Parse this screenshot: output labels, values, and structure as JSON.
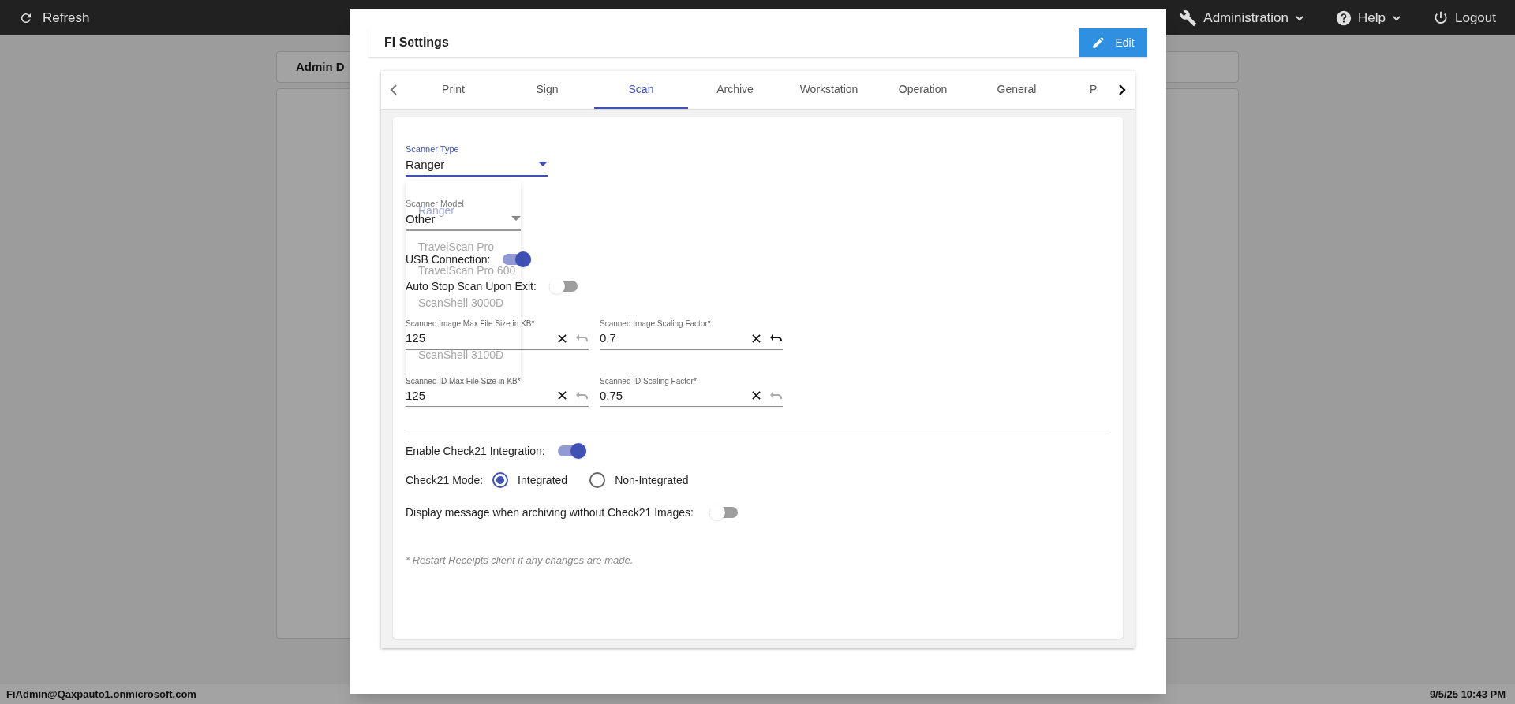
{
  "top_bar": {
    "refresh": "Refresh",
    "menus": [
      {
        "label": "Administration",
        "kind": "dropdown"
      },
      {
        "label": "Help",
        "kind": "dropdown"
      },
      {
        "label": "Logout",
        "kind": "plain"
      }
    ]
  },
  "background_card": {
    "title": "Admin D"
  },
  "dialog": {
    "title": "FI Settings",
    "edit_button": "Edit",
    "tabs": [
      {
        "label": "Print",
        "selected": false
      },
      {
        "label": "Sign",
        "selected": false
      },
      {
        "label": "Scan",
        "selected": true
      },
      {
        "label": "Archive",
        "selected": false
      },
      {
        "label": "Workstation",
        "selected": false
      },
      {
        "label": "Operation",
        "selected": false
      },
      {
        "label": "General",
        "selected": false
      },
      {
        "label": "P",
        "selected": false
      }
    ],
    "scanner_type": {
      "label": "Scanner Type",
      "value": "Ranger"
    },
    "scanner_model": {
      "label": "Scanner Model",
      "value": "Other"
    },
    "scanner_type_menu": [
      "Ranger",
      "TravelScan Pro",
      "TravelScan Pro 600",
      "ScanShell 3000D",
      "ScanShell 3100D"
    ],
    "toggles_top": [
      {
        "label": "USB Connection:",
        "on": true
      },
      {
        "label": "Auto Stop Scan Upon Exit:",
        "on": false
      }
    ],
    "number_fields": [
      {
        "label": "Scanned Image Max File Size in KB*",
        "value": "125",
        "undo_enabled": false
      },
      {
        "label": "Scanned Image Scaling Factor*",
        "value": "0.7",
        "undo_enabled": true
      },
      {
        "label": "Scanned ID Max File Size in KB*",
        "value": "125",
        "undo_enabled": false
      },
      {
        "label": "Scanned ID Scaling Factor*",
        "value": "0.75",
        "undo_enabled": false
      }
    ],
    "check21_toggle": {
      "label": "Enable Check21 Integration:",
      "on": true
    },
    "check21_mode": {
      "label": "Check21 Mode:",
      "options": [
        {
          "label": "Integrated",
          "selected": true
        },
        {
          "label": "Non-Integrated",
          "selected": false
        }
      ]
    },
    "display_message_toggle": {
      "label": "Display message when archiving without Check21 Images:",
      "on": false
    },
    "note": "* Restart Receipts client if any changes are made."
  },
  "status_bar": {
    "user": "FiAdmin@Qaxpauto1.onmicrosoft.com",
    "datetime": "9/5/25 10:43 PM"
  }
}
